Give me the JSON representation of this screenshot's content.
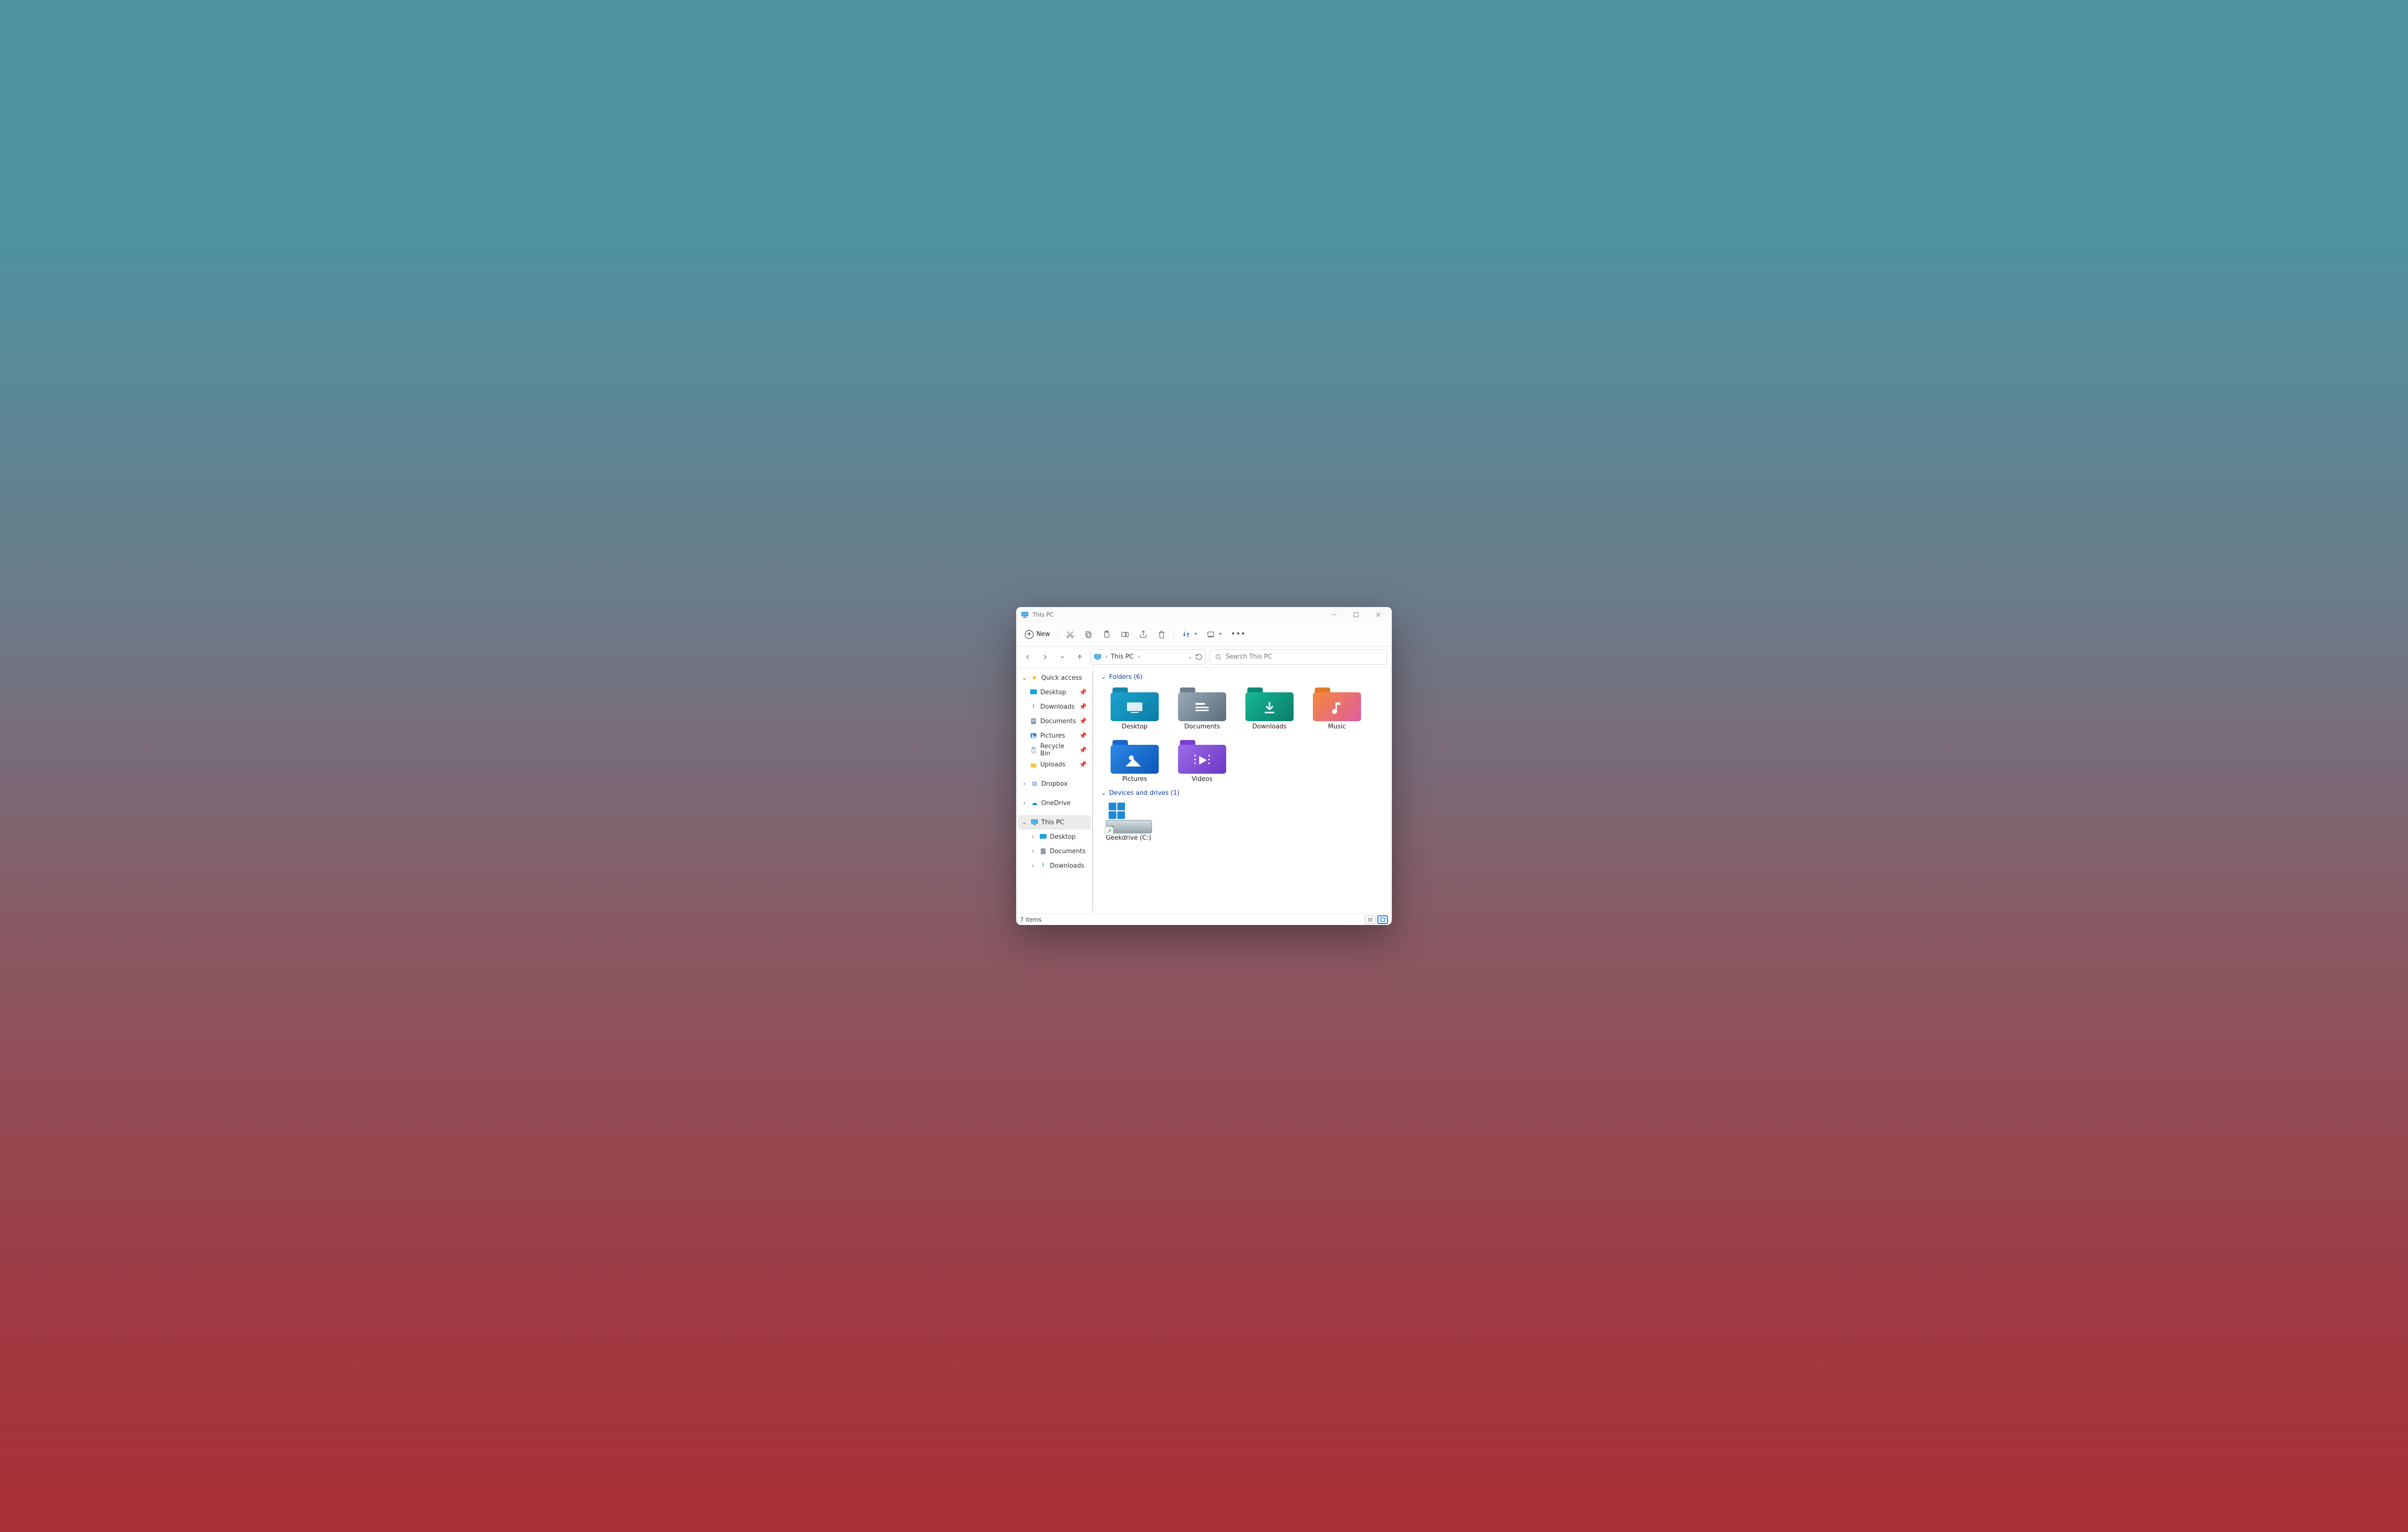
{
  "window": {
    "title": "This PC"
  },
  "toolbar": {
    "new_label": "New"
  },
  "address": {
    "location": "This PC"
  },
  "search": {
    "placeholder": "Search This PC"
  },
  "sidebar": {
    "quick_access": {
      "label": "Quick access",
      "items": [
        {
          "label": "Desktop"
        },
        {
          "label": "Downloads"
        },
        {
          "label": "Documents"
        },
        {
          "label": "Pictures"
        },
        {
          "label": "Recycle Bin"
        },
        {
          "label": "Uploads"
        }
      ]
    },
    "nodes": [
      {
        "label": "Dropbox"
      },
      {
        "label": "OneDrive"
      },
      {
        "label": "This PC",
        "selected": true,
        "children": [
          {
            "label": "Desktop"
          },
          {
            "label": "Documents"
          },
          {
            "label": "Downloads"
          }
        ]
      }
    ]
  },
  "groups": {
    "folders": {
      "title": "Folders (6)",
      "items": [
        {
          "label": "Desktop"
        },
        {
          "label": "Documents"
        },
        {
          "label": "Downloads"
        },
        {
          "label": "Music"
        },
        {
          "label": "Pictures"
        },
        {
          "label": "Videos"
        }
      ]
    },
    "drives": {
      "title": "Devices and drives (1)",
      "items": [
        {
          "label": "Geekdrive (C:)"
        }
      ]
    }
  },
  "status": {
    "text": "7 items"
  },
  "colors": {
    "desktop": {
      "back": "#1b86ad",
      "grad": [
        "#1aa4cf",
        "#0b7da6"
      ]
    },
    "documents": {
      "back": "#6f7d8c",
      "grad": [
        "#9aaab9",
        "#5b6c7b"
      ]
    },
    "downloads": {
      "back": "#0a8a74",
      "grad": [
        "#16b89a",
        "#0a7d67"
      ]
    },
    "music": {
      "back": "#e37a2b",
      "grad": [
        "#f48a3c",
        "#e05aa0"
      ]
    },
    "pictures": {
      "back": "#1667c9",
      "grad": [
        "#2a8ae6",
        "#0e55b8"
      ]
    },
    "videos": {
      "back": "#7a3fd1",
      "grad": [
        "#9a6de8",
        "#6e36c4"
      ]
    }
  }
}
